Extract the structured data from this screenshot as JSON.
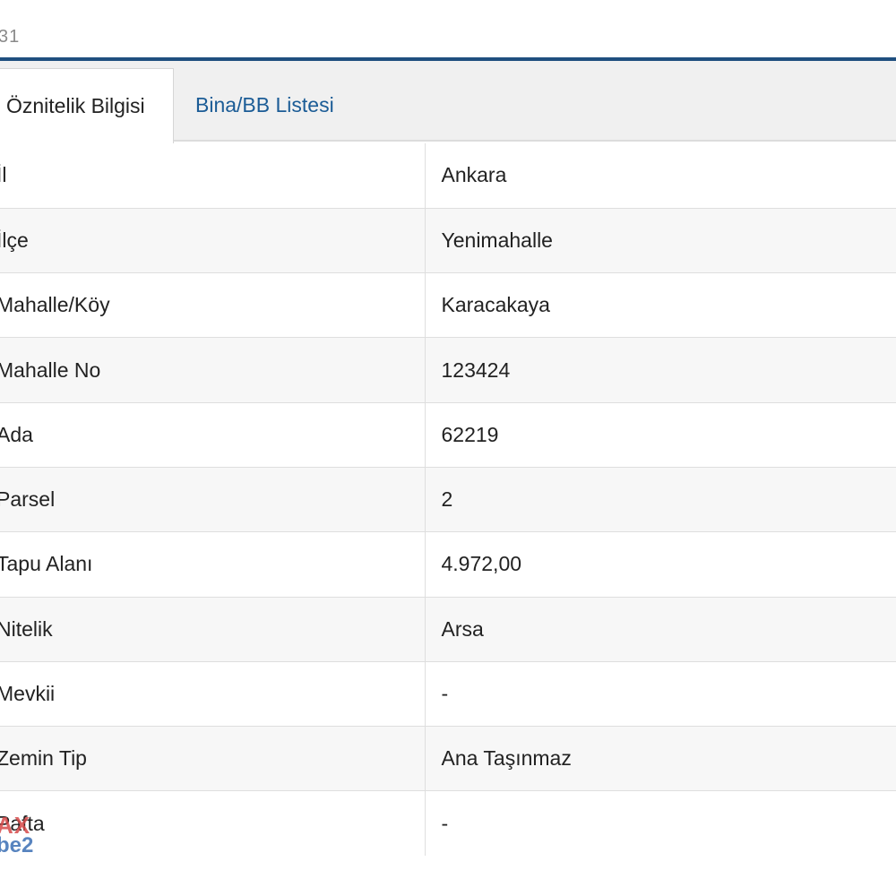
{
  "header": {
    "fragment": "31"
  },
  "tabs": [
    {
      "label": "Öznitelik Bilgisi",
      "active": true
    },
    {
      "label": "Bina/BB Listesi",
      "active": false
    }
  ],
  "rows": [
    {
      "label": "İl",
      "value": "Ankara"
    },
    {
      "label": "İlçe",
      "value": "Yenimahalle"
    },
    {
      "label": "Mahalle/Köy",
      "value": "Karacakaya"
    },
    {
      "label": "Mahalle No",
      "value": "123424"
    },
    {
      "label": "Ada",
      "value": "62219"
    },
    {
      "label": "Parsel",
      "value": "2"
    },
    {
      "label": "Tapu Alanı",
      "value": "4.972,00"
    },
    {
      "label": "Nitelik",
      "value": "Arsa"
    },
    {
      "label": "Mevkii",
      "value": "-"
    },
    {
      "label": "Zemin Tip",
      "value": "Ana Taşınmaz"
    },
    {
      "label": "Pafta",
      "value": "-"
    }
  ],
  "watermark": {
    "line1": "AX",
    "line2": "be2"
  },
  "colors": {
    "accent": "#1f4f7f",
    "link": "#1b5c96"
  }
}
